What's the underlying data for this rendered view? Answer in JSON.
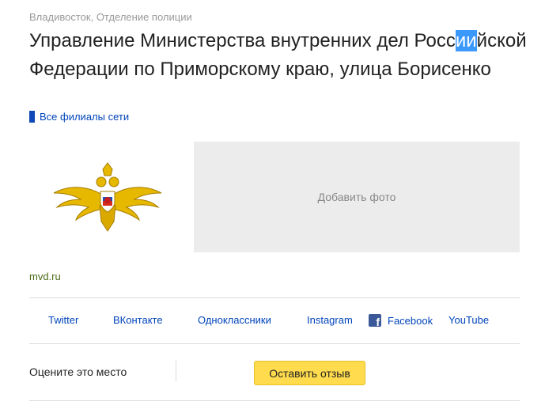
{
  "breadcrumb": {
    "city": "Владивосток",
    "separator": ",",
    "category": "Отделение полиции"
  },
  "title": {
    "part1": "Управление Министерства внутренних дел Росс",
    "selected": "ии",
    "part2": "йской Федерации по Приморскому краю, улица Борисенко"
  },
  "branches_link": "Все филиалы сети",
  "photo_placeholder": "Добавить фото",
  "website": "mvd.ru",
  "social_links": [
    {
      "label": "Twitter"
    },
    {
      "label": "ВКонтакте"
    },
    {
      "label": "Одноклассники"
    },
    {
      "label": "Instagram"
    },
    {
      "label": "Facebook",
      "icon": "facebook-icon"
    },
    {
      "label": "YouTube"
    }
  ],
  "rating": {
    "prompt": "Оцените это место",
    "button": "Оставить отзыв"
  },
  "colors": {
    "link": "#0044bb",
    "button": "#ffdb4d",
    "selection": "#3b99fc",
    "site_link": "#4b6a18"
  }
}
